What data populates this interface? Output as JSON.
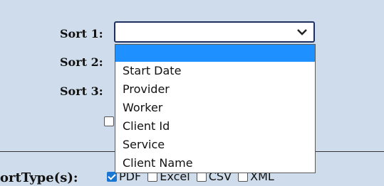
{
  "sort1": {
    "label": "Sort 1:",
    "value": ""
  },
  "sort2": {
    "label": "Sort 2:"
  },
  "sort3": {
    "label": "Sort 3:"
  },
  "dropdown": {
    "options": [
      "",
      "Start Date",
      "Provider",
      "Worker",
      "Client Id",
      "Service",
      "Client Name"
    ],
    "highlighted_index": 0
  },
  "report_types": {
    "label": "ortType(s):",
    "options": [
      {
        "label": "PDF",
        "checked": true
      },
      {
        "label": "Excel",
        "checked": false
      },
      {
        "label": "CSV",
        "checked": false
      },
      {
        "label": "XML",
        "checked": false
      }
    ]
  },
  "colors": {
    "background": "#cfdceb",
    "highlight": "#1e90ff",
    "checkbox_checked": "#1976d2"
  }
}
